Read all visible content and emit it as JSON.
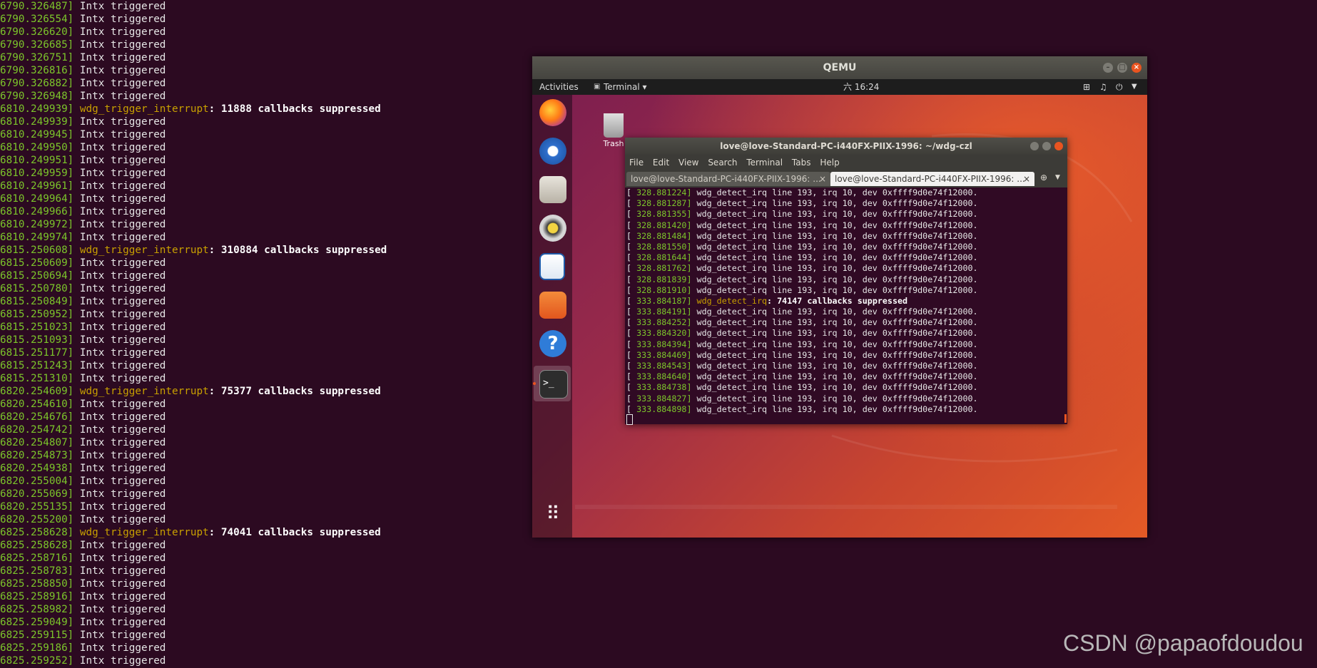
{
  "host_log": [
    {
      "ts": "6790.326487]",
      "msg": "Intx triggered"
    },
    {
      "ts": "6790.326554]",
      "msg": "Intx triggered"
    },
    {
      "ts": "6790.326620]",
      "msg": "Intx triggered"
    },
    {
      "ts": "6790.326685]",
      "msg": "Intx triggered"
    },
    {
      "ts": "6790.326751]",
      "msg": "Intx triggered"
    },
    {
      "ts": "6790.326816]",
      "msg": "Intx triggered"
    },
    {
      "ts": "6790.326882]",
      "msg": "Intx triggered"
    },
    {
      "ts": "6790.326948]",
      "msg": "Intx triggered"
    },
    {
      "ts": "6810.249939]",
      "fn": "wdg_trigger_interrupt",
      "bold": ": 11888 callbacks suppressed"
    },
    {
      "ts": "6810.249939]",
      "msg": "Intx triggered"
    },
    {
      "ts": "6810.249945]",
      "msg": "Intx triggered"
    },
    {
      "ts": "6810.249950]",
      "msg": "Intx triggered"
    },
    {
      "ts": "6810.249951]",
      "msg": "Intx triggered"
    },
    {
      "ts": "6810.249959]",
      "msg": "Intx triggered"
    },
    {
      "ts": "6810.249961]",
      "msg": "Intx triggered"
    },
    {
      "ts": "6810.249964]",
      "msg": "Intx triggered"
    },
    {
      "ts": "6810.249966]",
      "msg": "Intx triggered"
    },
    {
      "ts": "6810.249972]",
      "msg": "Intx triggered"
    },
    {
      "ts": "6810.249974]",
      "msg": "Intx triggered"
    },
    {
      "ts": "6815.250608]",
      "fn": "wdg_trigger_interrupt",
      "bold": ": 310884 callbacks suppressed"
    },
    {
      "ts": "6815.250609]",
      "msg": "Intx triggered"
    },
    {
      "ts": "6815.250694]",
      "msg": "Intx triggered"
    },
    {
      "ts": "6815.250780]",
      "msg": "Intx triggered"
    },
    {
      "ts": "6815.250849]",
      "msg": "Intx triggered"
    },
    {
      "ts": "6815.250952]",
      "msg": "Intx triggered"
    },
    {
      "ts": "6815.251023]",
      "msg": "Intx triggered"
    },
    {
      "ts": "6815.251093]",
      "msg": "Intx triggered"
    },
    {
      "ts": "6815.251177]",
      "msg": "Intx triggered"
    },
    {
      "ts": "6815.251243]",
      "msg": "Intx triggered"
    },
    {
      "ts": "6815.251310]",
      "msg": "Intx triggered"
    },
    {
      "ts": "6820.254609]",
      "fn": "wdg_trigger_interrupt",
      "bold": ": 75377 callbacks suppressed"
    },
    {
      "ts": "6820.254610]",
      "msg": "Intx triggered"
    },
    {
      "ts": "6820.254676]",
      "msg": "Intx triggered"
    },
    {
      "ts": "6820.254742]",
      "msg": "Intx triggered"
    },
    {
      "ts": "6820.254807]",
      "msg": "Intx triggered"
    },
    {
      "ts": "6820.254873]",
      "msg": "Intx triggered"
    },
    {
      "ts": "6820.254938]",
      "msg": "Intx triggered"
    },
    {
      "ts": "6820.255004]",
      "msg": "Intx triggered"
    },
    {
      "ts": "6820.255069]",
      "msg": "Intx triggered"
    },
    {
      "ts": "6820.255135]",
      "msg": "Intx triggered"
    },
    {
      "ts": "6820.255200]",
      "msg": "Intx triggered"
    },
    {
      "ts": "6825.258628]",
      "fn": "wdg_trigger_interrupt",
      "bold": ": 74041 callbacks suppressed"
    },
    {
      "ts": "6825.258628]",
      "msg": "Intx triggered"
    },
    {
      "ts": "6825.258716]",
      "msg": "Intx triggered"
    },
    {
      "ts": "6825.258783]",
      "msg": "Intx triggered"
    },
    {
      "ts": "6825.258850]",
      "msg": "Intx triggered"
    },
    {
      "ts": "6825.258916]",
      "msg": "Intx triggered"
    },
    {
      "ts": "6825.258982]",
      "msg": "Intx triggered"
    },
    {
      "ts": "6825.259049]",
      "msg": "Intx triggered"
    },
    {
      "ts": "6825.259115]",
      "msg": "Intx triggered"
    },
    {
      "ts": "6825.259186]",
      "msg": "Intx triggered"
    },
    {
      "ts": "6825.259252]",
      "msg": "Intx triggered"
    }
  ],
  "qemu": {
    "title": "QEMU",
    "topbar": {
      "activities": "Activities",
      "app_menu": "Terminal ▾",
      "clock": "六 16:24"
    },
    "desktop": {
      "trash_label": "Trash"
    },
    "dock_icons": [
      "firefox-icon",
      "thunderbird-icon",
      "files-icon",
      "rhythmbox-icon",
      "writer-icon",
      "software-icon",
      "help-icon",
      "terminal-icon",
      "show-apps-icon"
    ],
    "terminal": {
      "title": "love@love-Standard-PC-i440FX-PIIX-1996: ~/wdg-czl",
      "menu": [
        "File",
        "Edit",
        "View",
        "Search",
        "Terminal",
        "Tabs",
        "Help"
      ],
      "tabs": [
        {
          "label": "love@love-Standard-PC-i440FX-PIIX-1996: ...",
          "close": "×"
        },
        {
          "label": "love@love-Standard-PC-i440FX-PIIX-1996: ...",
          "close": "×"
        }
      ],
      "lines": [
        {
          "ts": "328.881224]",
          "msg": "wdg_detect_irq line 193, irq 10, dev 0xffff9d0e74f12000."
        },
        {
          "ts": "328.881287]",
          "msg": "wdg_detect_irq line 193, irq 10, dev 0xffff9d0e74f12000."
        },
        {
          "ts": "328.881355]",
          "msg": "wdg_detect_irq line 193, irq 10, dev 0xffff9d0e74f12000."
        },
        {
          "ts": "328.881420]",
          "msg": "wdg_detect_irq line 193, irq 10, dev 0xffff9d0e74f12000."
        },
        {
          "ts": "328.881484]",
          "msg": "wdg_detect_irq line 193, irq 10, dev 0xffff9d0e74f12000."
        },
        {
          "ts": "328.881550]",
          "msg": "wdg_detect_irq line 193, irq 10, dev 0xffff9d0e74f12000."
        },
        {
          "ts": "328.881644]",
          "msg": "wdg_detect_irq line 193, irq 10, dev 0xffff9d0e74f12000."
        },
        {
          "ts": "328.881762]",
          "msg": "wdg_detect_irq line 193, irq 10, dev 0xffff9d0e74f12000."
        },
        {
          "ts": "328.881839]",
          "msg": "wdg_detect_irq line 193, irq 10, dev 0xffff9d0e74f12000."
        },
        {
          "ts": "328.881910]",
          "msg": "wdg_detect_irq line 193, irq 10, dev 0xffff9d0e74f12000."
        },
        {
          "ts": "333.884187]",
          "fn": "wdg_detect_irq",
          "bold": ": 74147 callbacks suppressed"
        },
        {
          "ts": "333.884191]",
          "msg": "wdg_detect_irq line 193, irq 10, dev 0xffff9d0e74f12000."
        },
        {
          "ts": "333.884252]",
          "msg": "wdg_detect_irq line 193, irq 10, dev 0xffff9d0e74f12000."
        },
        {
          "ts": "333.884320]",
          "msg": "wdg_detect_irq line 193, irq 10, dev 0xffff9d0e74f12000."
        },
        {
          "ts": "333.884394]",
          "msg": "wdg_detect_irq line 193, irq 10, dev 0xffff9d0e74f12000."
        },
        {
          "ts": "333.884469]",
          "msg": "wdg_detect_irq line 193, irq 10, dev 0xffff9d0e74f12000."
        },
        {
          "ts": "333.884543]",
          "msg": "wdg_detect_irq line 193, irq 10, dev 0xffff9d0e74f12000."
        },
        {
          "ts": "333.884640]",
          "msg": "wdg_detect_irq line 193, irq 10, dev 0xffff9d0e74f12000."
        },
        {
          "ts": "333.884738]",
          "msg": "wdg_detect_irq line 193, irq 10, dev 0xffff9d0e74f12000."
        },
        {
          "ts": "333.884827]",
          "msg": "wdg_detect_irq line 193, irq 10, dev 0xffff9d0e74f12000."
        },
        {
          "ts": "333.884898]",
          "msg": "wdg_detect_irq line 193, irq 10, dev 0xffff9d0e74f12000."
        }
      ]
    }
  },
  "watermark": "CSDN @papaofdoudou",
  "colors": {
    "background": "#2c0a21",
    "timestamp": "#7cc52b",
    "function": "#c8a000",
    "ubuntu_orange": "#e95420"
  }
}
